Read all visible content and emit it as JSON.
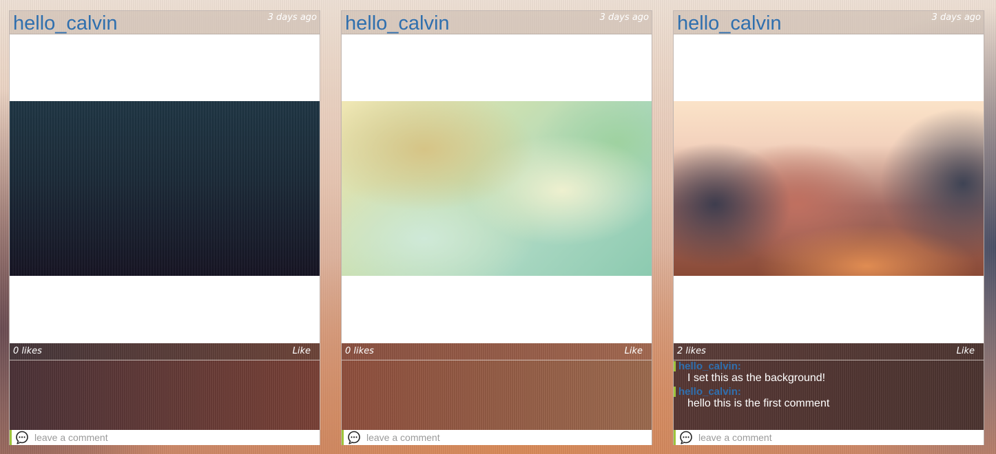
{
  "comment_placeholder": "leave a comment",
  "posts": [
    {
      "username": "hello_calvin",
      "timestamp": "3 days ago",
      "likes": "0 likes",
      "like_label": "Like",
      "image": "dark-blue-blurred-wallpaper",
      "comments": []
    },
    {
      "username": "hello_calvin",
      "timestamp": "3 days ago",
      "likes": "0 likes",
      "like_label": "Like",
      "image": "green-yellow-blurred-wallpaper",
      "comments": []
    },
    {
      "username": "hello_calvin",
      "timestamp": "3 days ago",
      "likes": "2 likes",
      "like_label": "Like",
      "image": "sunset-blurred-wallpaper",
      "comments": [
        {
          "author": "hello_calvin:",
          "text": "I set this as the background!"
        },
        {
          "author": "hello_calvin:",
          "text": "hello this is the first comment"
        }
      ]
    }
  ],
  "colors": {
    "username": "#2f6fae",
    "comment_marker": "#9ec43a",
    "meta_text": "#ffffff"
  }
}
